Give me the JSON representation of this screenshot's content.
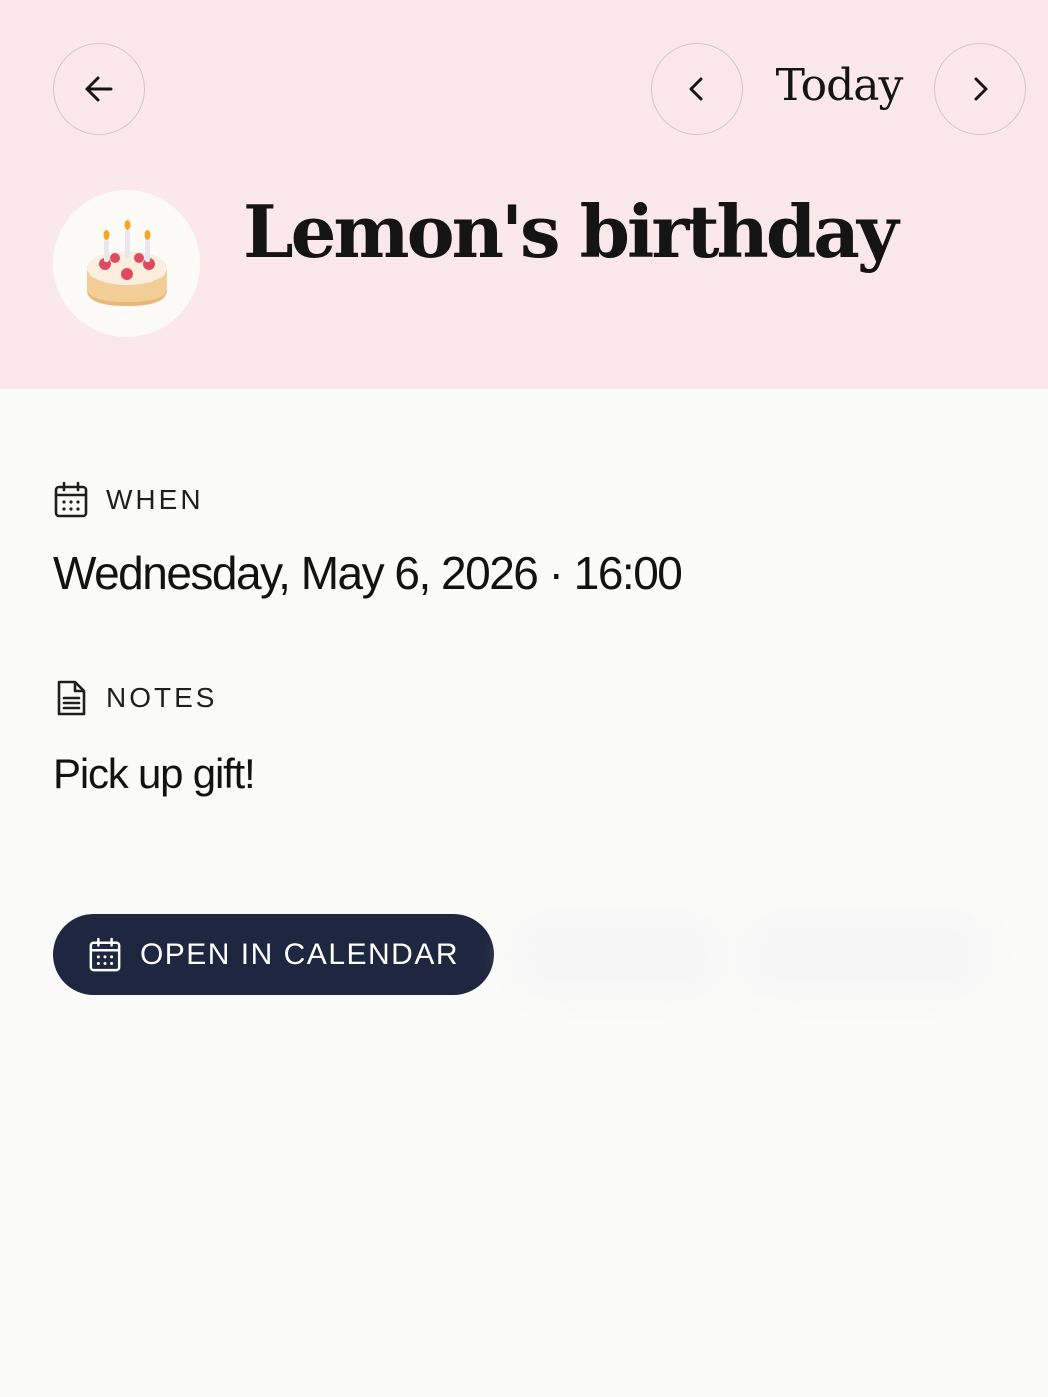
{
  "header": {
    "back_button_label": "Back",
    "today_label": "Today",
    "prev_button_label": "Previous",
    "next_button_label": "Next",
    "emoji": "🎂",
    "title": "Lemon's birthday",
    "background": "#fbe8ec"
  },
  "when": {
    "label": "WHEN",
    "value": "Wednesday, May 6, 2026 · 16:00",
    "icon": "calendar-icon"
  },
  "notes": {
    "label": "NOTES",
    "value": "Pick up gift!",
    "icon": "document-icon"
  },
  "actions": {
    "open_calendar_label": "OPEN IN CALENDAR",
    "open_calendar_icon": "calendar-icon",
    "button_color": "#1f2740"
  }
}
